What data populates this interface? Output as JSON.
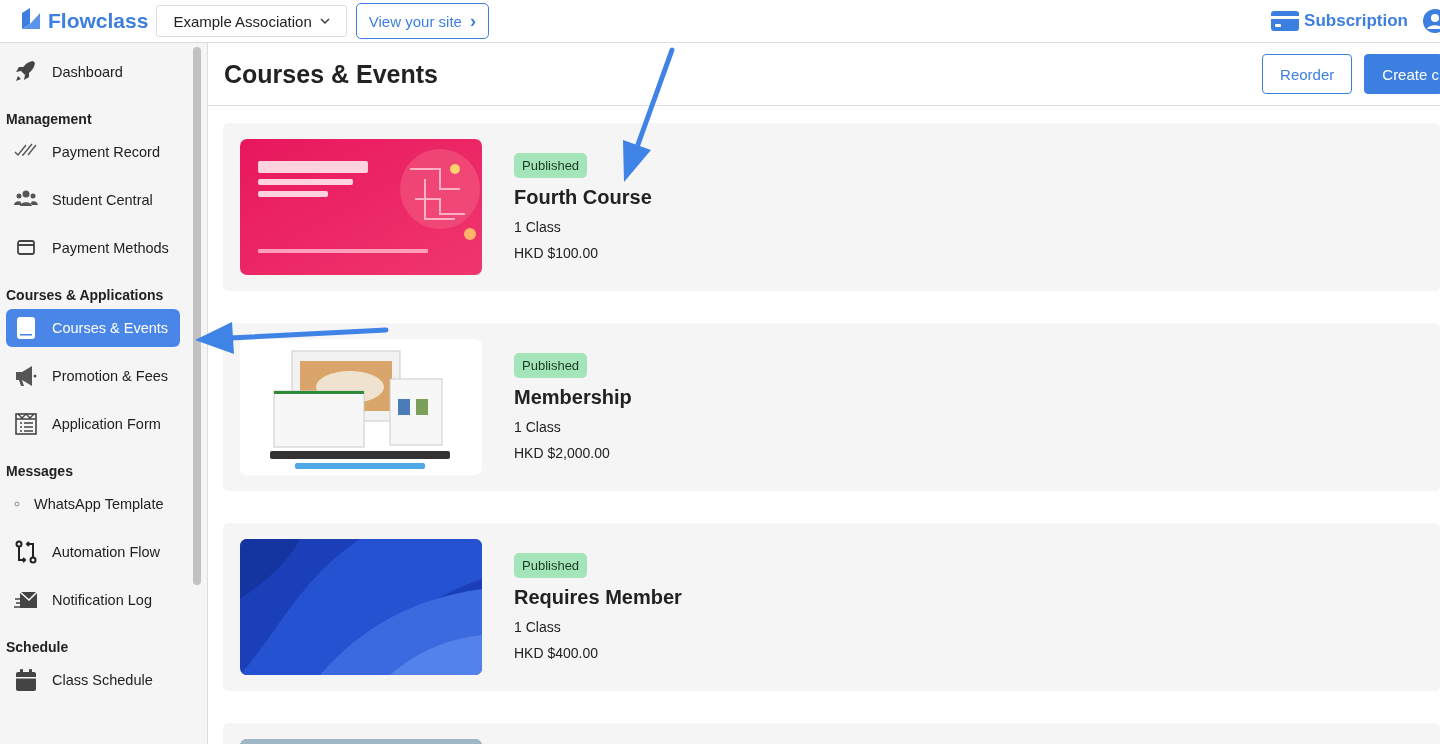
{
  "header": {
    "brand": "Flowclass",
    "organization": "Example Association",
    "view_site": "View your site",
    "view_site_chevron": "›",
    "subscription": "Subscription"
  },
  "sidebar": {
    "items": [
      {
        "kind": "item",
        "label": "Dashboard",
        "selected": false
      },
      {
        "kind": "heading",
        "label": "Management"
      },
      {
        "kind": "item",
        "label": "Payment Record",
        "selected": false
      },
      {
        "kind": "item",
        "label": "Student Central",
        "selected": false
      },
      {
        "kind": "item",
        "label": "Payment Methods",
        "selected": false
      },
      {
        "kind": "heading",
        "label": "Courses & Applications"
      },
      {
        "kind": "item",
        "label": "Courses & Events",
        "selected": true
      },
      {
        "kind": "item",
        "label": "Promotion & Fees",
        "selected": false
      },
      {
        "kind": "item",
        "label": "Application Form",
        "selected": false
      },
      {
        "kind": "heading",
        "label": "Messages"
      },
      {
        "kind": "item",
        "label": "WhatsApp Template",
        "selected": false
      },
      {
        "kind": "item",
        "label": "Automation Flow",
        "selected": false
      },
      {
        "kind": "item",
        "label": "Notification Log",
        "selected": false
      },
      {
        "kind": "heading",
        "label": "Schedule"
      },
      {
        "kind": "item",
        "label": "Class Schedule",
        "selected": false
      }
    ]
  },
  "page": {
    "title": "Courses & Events",
    "buttons": [
      {
        "kind": "outline",
        "label": "Reorder"
      },
      {
        "kind": "primary",
        "label": "Create c"
      }
    ]
  },
  "courses": [
    {
      "kind": "picture",
      "status": "Published",
      "title": "Fourth Course",
      "classes": "1 Class",
      "price": "HKD $100.00"
    },
    {
      "kind": "picture",
      "status": "Published",
      "title": "Membership",
      "classes": "1 Class",
      "price": "HKD $2,000.00"
    },
    {
      "kind": "picture",
      "status": "Published",
      "title": "Requires Member",
      "classes": "1 Class",
      "price": "HKD $400.00"
    },
    {
      "kind": "picture"
    }
  ]
}
